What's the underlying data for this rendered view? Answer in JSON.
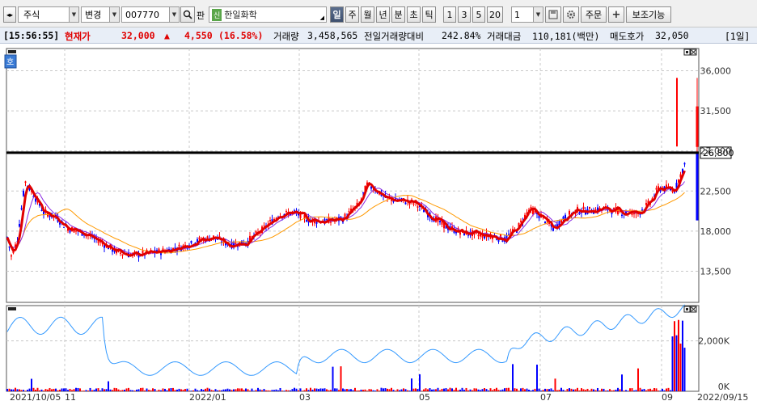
{
  "toolbar": {
    "nav_arrows": "◂▸",
    "market": "주식",
    "change_label": "변경",
    "code": "007770",
    "search_icon": "🔍",
    "pan_label": "판",
    "stock_badge": "신",
    "stock_name": "한일화학",
    "periods": [
      "일",
      "주",
      "월",
      "년",
      "분",
      "초",
      "틱"
    ],
    "active_period": "일",
    "intervals": [
      "1",
      "3",
      "5",
      "20"
    ],
    "count_value": "1",
    "order_label": "주문",
    "plus_label": "+",
    "assist_label": "보조기능"
  },
  "status": {
    "time": "[15:56:55]",
    "price_label": "현재가",
    "price": "32,000",
    "arrow": "▲",
    "change": "4,550",
    "change_pct": "(16.58%)",
    "volume_label": "거래량",
    "volume": "3,458,565",
    "prev_vol_label": "전일거래량대비",
    "prev_vol_pct": "242.84%",
    "amount_label": "거래대금",
    "amount": "110,181(백만)",
    "ask_label": "매도호가",
    "ask": "32,050",
    "page": "[1일]"
  },
  "colors": {
    "up": "#ff0000",
    "down": "#0000ff",
    "ma_thick": "#e00000",
    "ma_thin": "#8a2be2",
    "ma_orange": "#ff9900",
    "volume_line": "#3399ff",
    "highlight_line": "#000000",
    "price_tag_bg": "#ffffff"
  },
  "chart_data": [
    {
      "type": "candlestick",
      "y_ticks": [
        "36,000",
        "31,500",
        "27,000",
        "22,500",
        "18,000",
        "13,500"
      ],
      "ylim": [
        10000,
        38500
      ],
      "highlight_level": 26800,
      "highlight_label": "26,800",
      "segments": [
        [
          0,
          17300
        ],
        [
          5,
          15200
        ],
        [
          12,
          16800
        ],
        [
          22,
          23600
        ],
        [
          32,
          22200
        ],
        [
          45,
          20100
        ],
        [
          60,
          19600
        ],
        [
          75,
          18300
        ],
        [
          95,
          17800
        ],
        [
          115,
          16800
        ],
        [
          135,
          15700
        ],
        [
          155,
          15300
        ],
        [
          175,
          15500
        ],
        [
          195,
          15800
        ],
        [
          215,
          16200
        ],
        [
          235,
          16900
        ],
        [
          255,
          17300
        ],
        [
          275,
          16500
        ],
        [
          295,
          16700
        ],
        [
          315,
          18100
        ],
        [
          335,
          19800
        ],
        [
          355,
          20100
        ],
        [
          375,
          19200
        ],
        [
          395,
          19100
        ],
        [
          415,
          19400
        ],
        [
          435,
          21000
        ],
        [
          445,
          23200
        ],
        [
          455,
          22700
        ],
        [
          470,
          21600
        ],
        [
          490,
          21400
        ],
        [
          505,
          21100
        ],
        [
          520,
          20000
        ],
        [
          540,
          18600
        ],
        [
          560,
          17900
        ],
        [
          580,
          17600
        ],
        [
          600,
          17400
        ],
        [
          615,
          17100
        ],
        [
          630,
          18200
        ],
        [
          645,
          20400
        ],
        [
          660,
          19700
        ],
        [
          675,
          18300
        ],
        [
          690,
          19600
        ],
        [
          705,
          20300
        ],
        [
          720,
          20300
        ],
        [
          740,
          20500
        ],
        [
          760,
          20100
        ],
        [
          780,
          20000
        ],
        [
          795,
          21200
        ],
        [
          805,
          22800
        ],
        [
          815,
          22800
        ],
        [
          825,
          22600
        ],
        [
          832,
          24200
        ],
        [
          838,
          25500
        ]
      ],
      "last_candle": {
        "open": 27450,
        "high": 35200,
        "low": 26500,
        "close": 32000
      }
    },
    {
      "type": "bar",
      "series": "volume",
      "y_ticks": [
        "2,000K",
        "0K"
      ],
      "ylim": [
        0,
        3400000
      ],
      "x_tick_labels": [
        "2021/10/05",
        "11",
        "2022/01",
        "03",
        "05",
        "07",
        "09",
        "2022/09/15"
      ]
    }
  ]
}
